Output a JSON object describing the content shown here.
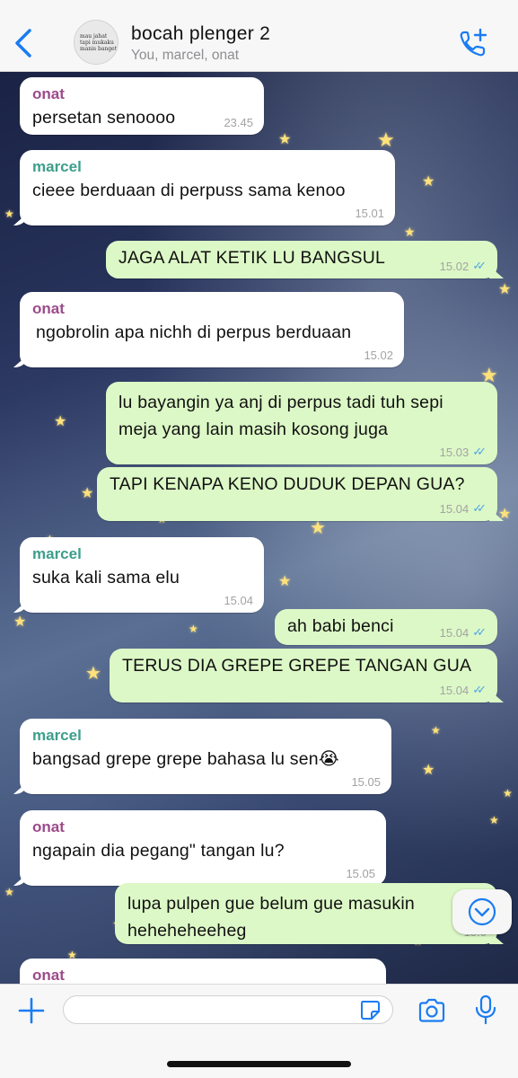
{
  "header": {
    "title": "bocah plenger 2",
    "subtitle": "You, marcel, onat",
    "avatar_text": "mau jahat tapi mukaku manis banget"
  },
  "messages": [
    {
      "sender": "onat",
      "text": "persetan senoooo",
      "time": "23.45"
    },
    {
      "sender": "marcel",
      "text": "cieee berduaan di perpuss sama kenoo",
      "time": "15.01"
    },
    {
      "text": "JAGA ALAT KETIK LU BANGSUL",
      "time": "15.02",
      "ticks": "✓✓"
    },
    {
      "sender": "onat",
      "text": "ngobrolin apa nichh di perpus berduaan",
      "time": "15.02"
    },
    {
      "lines": [
        "lu bayangin ya anj di perpus tadi tuh sepi",
        "meja yang lain masih kosong juga"
      ],
      "time": "15.03",
      "ticks": "✓✓"
    },
    {
      "text": "TAPI KENAPA KENO DUDUK DEPAN GUA?",
      "time": "15.04",
      "ticks": "✓✓"
    },
    {
      "sender": "marcel",
      "text": "suka kali sama elu",
      "time": "15.04"
    },
    {
      "text": "ah babi benci",
      "time": "15.04",
      "ticks": "✓✓"
    },
    {
      "text": "TERUS DIA GREPE GREPE TANGAN GUA",
      "time": "15.04",
      "ticks": "✓✓"
    },
    {
      "sender": "marcel",
      "text": "bangsad grepe grepe bahasa lu sen😭",
      "time": "15.05"
    },
    {
      "sender": "onat",
      "text": "ngapain dia pegang\" tangan lu?",
      "time": "15.05"
    },
    {
      "lines": [
        "lupa pulpen gue belum gue masukin",
        "heheheheeheg"
      ],
      "time": "15.0"
    },
    {
      "sender": "onat"
    }
  ],
  "composer": {
    "value": "",
    "placeholder": ""
  },
  "colors": {
    "incoming_bubble": "#ffffff",
    "outgoing_bubble": "#dcf8c6",
    "onat": "#9c4a8a",
    "marcel": "#3d9e8c",
    "accent": "#1a7cf2"
  }
}
